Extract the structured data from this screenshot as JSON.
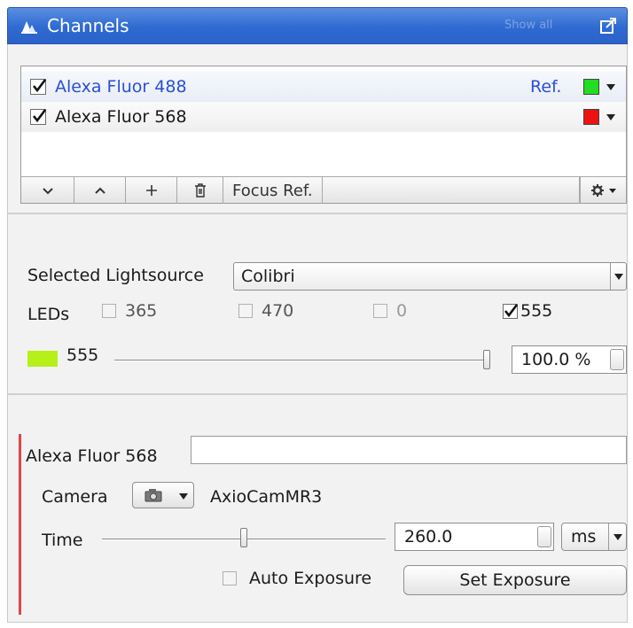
{
  "window": {
    "title": "Channels",
    "faded_label": "Show all",
    "icon": "channels-icon",
    "undock_icon": "undock-icon"
  },
  "channels": [
    {
      "name": "Alexa Fluor 488",
      "checked": true,
      "ref_label": "Ref.",
      "color": "#22dd22",
      "highlight": true
    },
    {
      "name": "Alexa Fluor 568",
      "checked": true,
      "ref_label": "",
      "color": "#ee1111",
      "highlight": false
    }
  ],
  "channel_toolbar": {
    "down_icon": "chevron-down-icon",
    "up_icon": "chevron-up-icon",
    "add_icon": "plus-icon",
    "delete_icon": "trash-icon",
    "focus_ref_label": "Focus Ref.",
    "settings_icon": "gear-icon"
  },
  "lightsource": {
    "label": "Selected Lightsource",
    "value": "Colibri"
  },
  "leds": {
    "label": "LEDs",
    "items": [
      {
        "label": "365",
        "checked": false,
        "enabled": true
      },
      {
        "label": "470",
        "checked": false,
        "enabled": true
      },
      {
        "label": "0",
        "checked": false,
        "enabled": false
      },
      {
        "label": "555",
        "checked": true,
        "enabled": true
      }
    ],
    "active": {
      "label": "555",
      "color": "#b7ef19",
      "intensity": 1.0,
      "intensity_text": "100.0 %"
    }
  },
  "channel_settings": {
    "name": "Alexa Fluor 568",
    "description": "",
    "camera_label": "Camera",
    "camera_name": "AxioCamMR3",
    "time_label": "Time",
    "time_value": "260.0",
    "time_slider_fraction": 0.5,
    "time_unit": "ms",
    "auto_exposure_label": "Auto Exposure",
    "auto_exposure_checked": false,
    "set_exposure_label": "Set Exposure"
  }
}
